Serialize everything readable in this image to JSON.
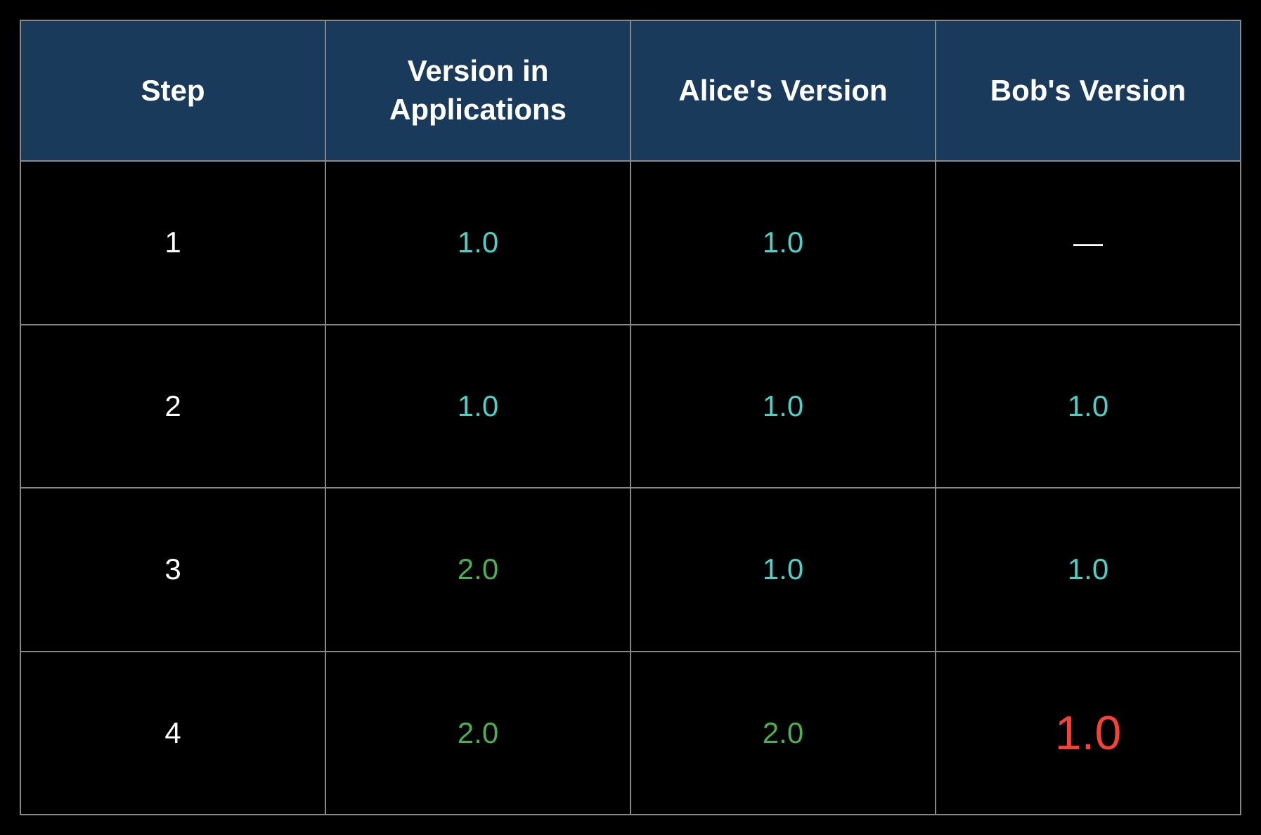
{
  "chart_data": {
    "type": "table",
    "headers": [
      "Step",
      "Version in Applications",
      "Alice's Version",
      "Bob's Version"
    ],
    "rows": [
      {
        "step": "1",
        "applications": "1.0",
        "alice": "1.0",
        "bob": "—"
      },
      {
        "step": "2",
        "applications": "1.0",
        "alice": "1.0",
        "bob": "1.0"
      },
      {
        "step": "3",
        "applications": "2.0",
        "alice": "1.0",
        "bob": "1.0"
      },
      {
        "step": "4",
        "applications": "2.0",
        "alice": "2.0",
        "bob": "1.0"
      }
    ]
  },
  "headers": {
    "col0": "Step",
    "col1": "Version in Applications",
    "col2": "Alice's Version",
    "col3": "Bob's Version"
  },
  "cells": {
    "r0c0": "1",
    "r0c1": "1.0",
    "r0c2": "1.0",
    "r0c3": "—",
    "r1c0": "2",
    "r1c1": "1.0",
    "r1c2": "1.0",
    "r1c3": "1.0",
    "r2c0": "3",
    "r2c1": "2.0",
    "r2c2": "1.0",
    "r2c3": "1.0",
    "r3c0": "4",
    "r3c1": "2.0",
    "r3c2": "2.0",
    "r3c3": "1.0"
  },
  "styles": {
    "colors": {
      "header_bg": "#1a3a5c",
      "teal": "#4dd0c7",
      "green": "#4caf50",
      "red": "#f44336",
      "white": "#ffffff",
      "black": "#000000"
    }
  }
}
